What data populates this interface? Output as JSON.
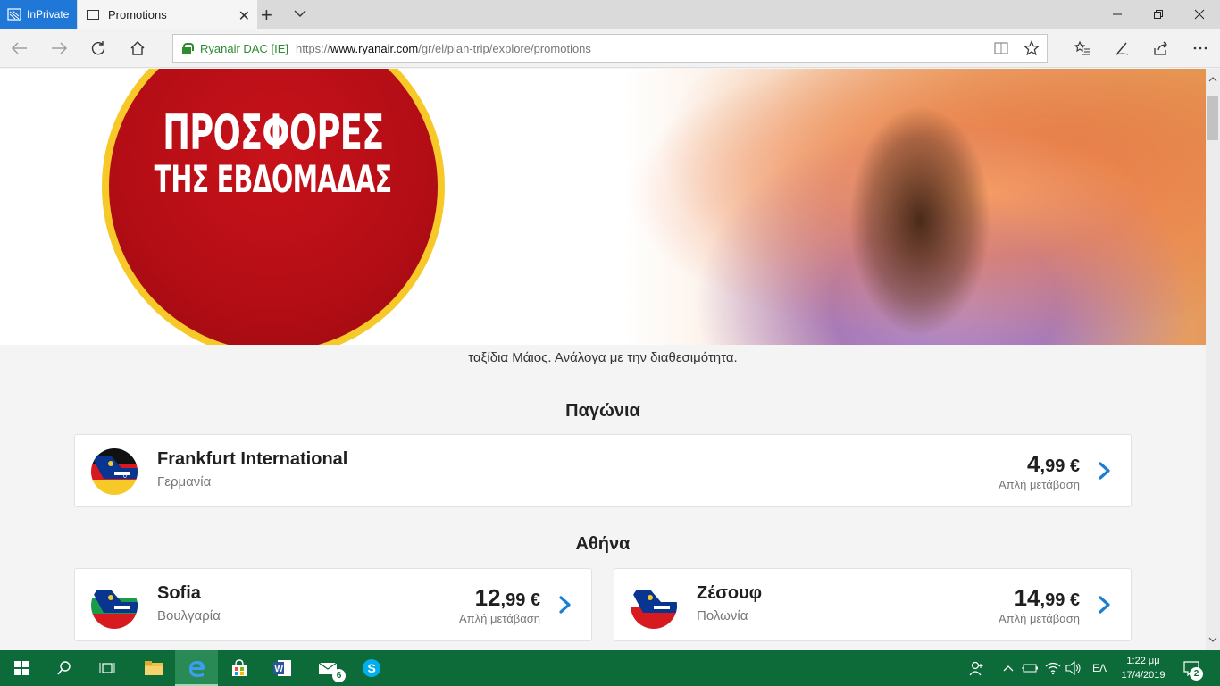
{
  "browser": {
    "inprivate_label": "InPrivate",
    "tab_title": "Promotions",
    "tab_close": "✕",
    "new_tab": "+",
    "window_controls": [
      "minimize-icon",
      "restore-icon",
      "close-icon"
    ],
    "site_identity": "Ryanair DAC [IE]",
    "url_proto": "https://",
    "url_host": "www.ryanair.com",
    "url_path": "/gr/el/plan-trip/explore/promotions"
  },
  "hero": {
    "badge_line1": "ΠΡΟΣΦΟΡΕΣ",
    "badge_line2": "ΤΗΣ ΕΒΔΟΜΑΔΑΣ",
    "badge_color": "#c8121a",
    "badge_ring_color": "#f6c928"
  },
  "promo_text": "ταξίδια Μάιος. Ανάλογα με την διαθεσιμότητα.",
  "sections": [
    {
      "title": "Παγώνια",
      "cards": [
        {
          "name": "Frankfurt International",
          "country": "Γερμανία",
          "price_int": "4",
          "price_dec": ",99 €",
          "label": "Απλή μετάβαση",
          "flag": "germany"
        }
      ]
    },
    {
      "title": "Αθήνα",
      "cards": [
        {
          "name": "Sofia",
          "country": "Βουλγαρία",
          "price_int": "12",
          "price_dec": ",99 €",
          "label": "Απλή μετάβαση",
          "flag": "bulgaria"
        },
        {
          "name": "Ζέσουφ",
          "country": "Πολωνία",
          "price_int": "14",
          "price_dec": ",99 €",
          "label": "Απλή μετάβαση",
          "flag": "poland"
        }
      ]
    }
  ],
  "colors": {
    "accent_chevron": "#1a7fd4",
    "ryanair_navy": "#073590",
    "taskbar": "#0d6b3a"
  },
  "taskbar": {
    "mail_badge": "6",
    "language": "ΕΛ",
    "time": "1:22 μμ",
    "date": "17/4/2019",
    "notification_count": "2"
  }
}
